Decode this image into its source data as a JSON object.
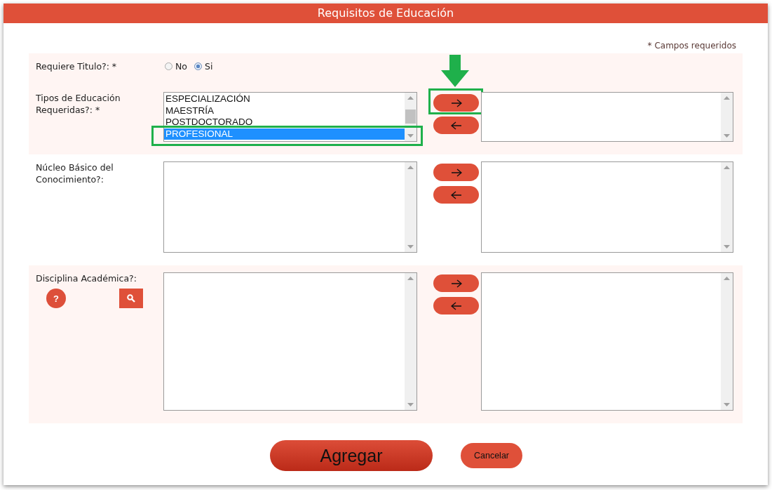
{
  "window": {
    "title": "Requisitos de Educación"
  },
  "required_note": "* Campos requeridos",
  "sections": [
    {
      "kind": "radio",
      "shaded": true,
      "label": "Requiere Titulo?: *",
      "options": [
        {
          "label": "No",
          "selected": false
        },
        {
          "label": "Si",
          "selected": true
        }
      ]
    },
    {
      "kind": "transfer",
      "shaded": true,
      "label": "Tipos de Educación Requeridas?: *",
      "items": [
        {
          "label": "ESPECIALIZACIÓN",
          "selected": false,
          "highlighted": false
        },
        {
          "label": "MAESTRÍA",
          "selected": false,
          "highlighted": false
        },
        {
          "label": "POSTDOCTORADO",
          "selected": false,
          "highlighted": false
        },
        {
          "label": "PROFESIONAL",
          "selected": true,
          "highlighted": true
        }
      ],
      "add_highlighted": true,
      "scroll_thumb": true
    },
    {
      "kind": "transfer",
      "label": "Núcleo Básico del Conocimiento?:"
    },
    {
      "kind": "transfer",
      "shaded": true,
      "label": "Disciplina Académica?:",
      "help_label": "?"
    }
  ],
  "buttons": [
    {
      "label": "Agregar",
      "kind": "primary"
    },
    {
      "label": "Cancelar",
      "kind": "secondary"
    }
  ]
}
